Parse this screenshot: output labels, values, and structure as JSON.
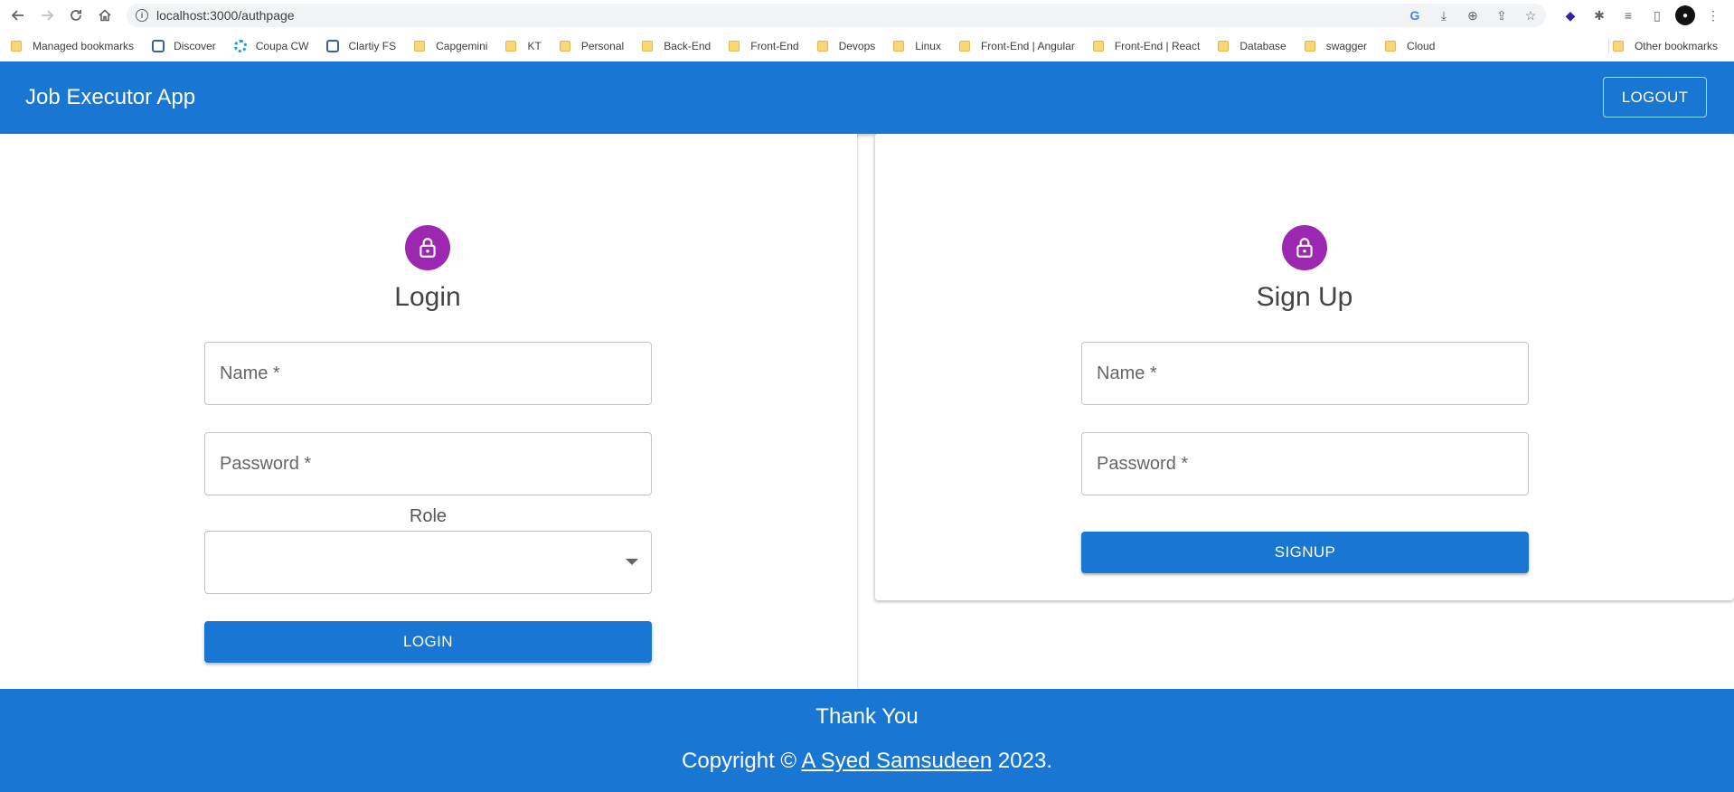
{
  "browser": {
    "url": "localhost:3000/authpage",
    "bookmarks": [
      {
        "label": "Managed bookmarks",
        "icon": "folder-icon"
      },
      {
        "label": "Discover",
        "icon": "globe-icon"
      },
      {
        "label": "Coupa CW",
        "icon": "spin-icon"
      },
      {
        "label": "Clartiy FS",
        "icon": "globe-icon"
      },
      {
        "label": "Capgemini",
        "icon": "folder-icon"
      },
      {
        "label": "KT",
        "icon": "folder-icon"
      },
      {
        "label": "Personal",
        "icon": "folder-icon"
      },
      {
        "label": "Back-End",
        "icon": "folder-icon"
      },
      {
        "label": "Front-End",
        "icon": "folder-icon"
      },
      {
        "label": "Devops",
        "icon": "folder-icon"
      },
      {
        "label": "Linux",
        "icon": "folder-icon"
      },
      {
        "label": "Front-End | Angular",
        "icon": "folder-icon"
      },
      {
        "label": "Front-End | React",
        "icon": "folder-icon"
      },
      {
        "label": "Database",
        "icon": "folder-icon"
      },
      {
        "label": "swagger",
        "icon": "folder-icon"
      },
      {
        "label": "Cloud",
        "icon": "folder-icon"
      }
    ],
    "other_bookmarks": "Other bookmarks"
  },
  "appbar": {
    "title": "Job Executor App",
    "logout_label": "LOGOUT",
    "color": "#1976d2"
  },
  "login": {
    "title": "Login",
    "name_label": "Name *",
    "password_label": "Password *",
    "role_label": "Role",
    "role_value": "",
    "button_label": "LOGIN"
  },
  "signup": {
    "title": "Sign Up",
    "name_label": "Name *",
    "password_label": "Password *",
    "button_label": "SIGNUP"
  },
  "footer": {
    "thanks": "Thank You",
    "copyright_prefix": "Copyright ©",
    "author": "A Syed Samsudeen",
    "year_suffix": "2023."
  },
  "colors": {
    "primary": "#1976d2",
    "avatar": "#9c27b0"
  }
}
